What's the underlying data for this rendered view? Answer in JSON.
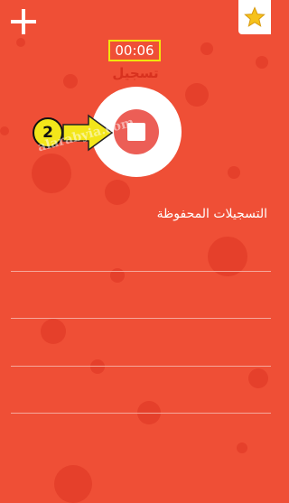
{
  "header": {
    "timer": "00:06",
    "recording_label": "تسجيل"
  },
  "saved": {
    "title": "التسجيلات المحفوظة"
  },
  "annotation": {
    "step_number": "2",
    "watermark": "alarabyia.com"
  },
  "colors": {
    "background": "#ef4f36",
    "accent": "#f3e61a",
    "stop": "#ec5e56"
  },
  "icons": [
    "plus-icon",
    "star-icon",
    "stop-icon"
  ]
}
